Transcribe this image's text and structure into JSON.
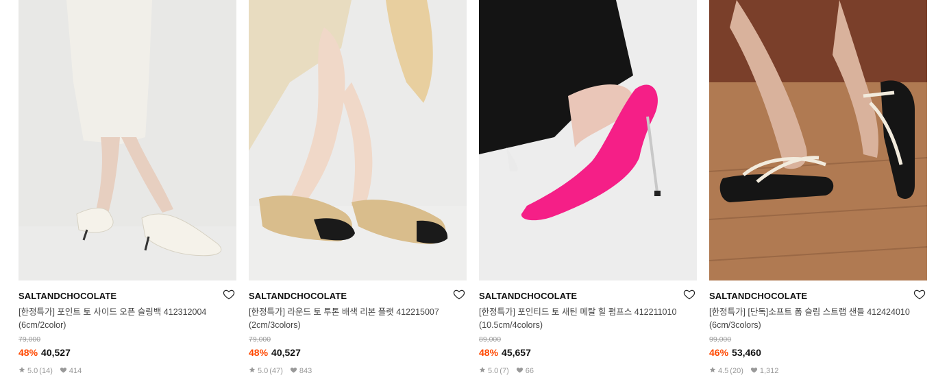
{
  "products": [
    {
      "image": "product-photo-slingback-heels",
      "brand": "SALTANDCHOCOLATE",
      "name_line1": "[한정특가] 포인트 토 사이드 오픈 슬링백 412312004",
      "name_line2": "(6cm/2color)",
      "original_price": "79,000",
      "discount": "48%",
      "price": "40,527",
      "rating": "5.0",
      "reviews": "(14)",
      "likes": "414"
    },
    {
      "image": "product-photo-ballet-flats",
      "brand": "SALTANDCHOCOLATE",
      "name_line1": "[한정특가] 라운드 토 투톤 배색 리본 플랫 412215007",
      "name_line2": "(2cm/3colors)",
      "original_price": "79,000",
      "discount": "48%",
      "price": "40,527",
      "rating": "5.0",
      "reviews": "(47)",
      "likes": "843"
    },
    {
      "image": "product-photo-pink-pumps",
      "brand": "SALTANDCHOCOLATE",
      "name_line1": "[한정특가] 포인티드 토 새틴 메탈 힐 펌프스 412211010",
      "name_line2": "(10.5cm/4colors)",
      "original_price": "89,000",
      "discount": "48%",
      "price": "45,657",
      "rating": "5.0",
      "reviews": "(7)",
      "likes": "66"
    },
    {
      "image": "product-photo-strap-sandals",
      "brand": "SALTANDCHOCOLATE",
      "name_line1": "[한정특가] [단독]소프트 폼 슬림 스트랩 샌들 412424010",
      "name_line2": "(6cm/3colors)",
      "original_price": "99,000",
      "discount": "46%",
      "price": "53,460",
      "rating": "4.5",
      "reviews": "(20)",
      "likes": "1,312"
    }
  ],
  "colors": {
    "discount": "#ff4800",
    "meta": "#999999",
    "brand": "#111111"
  }
}
